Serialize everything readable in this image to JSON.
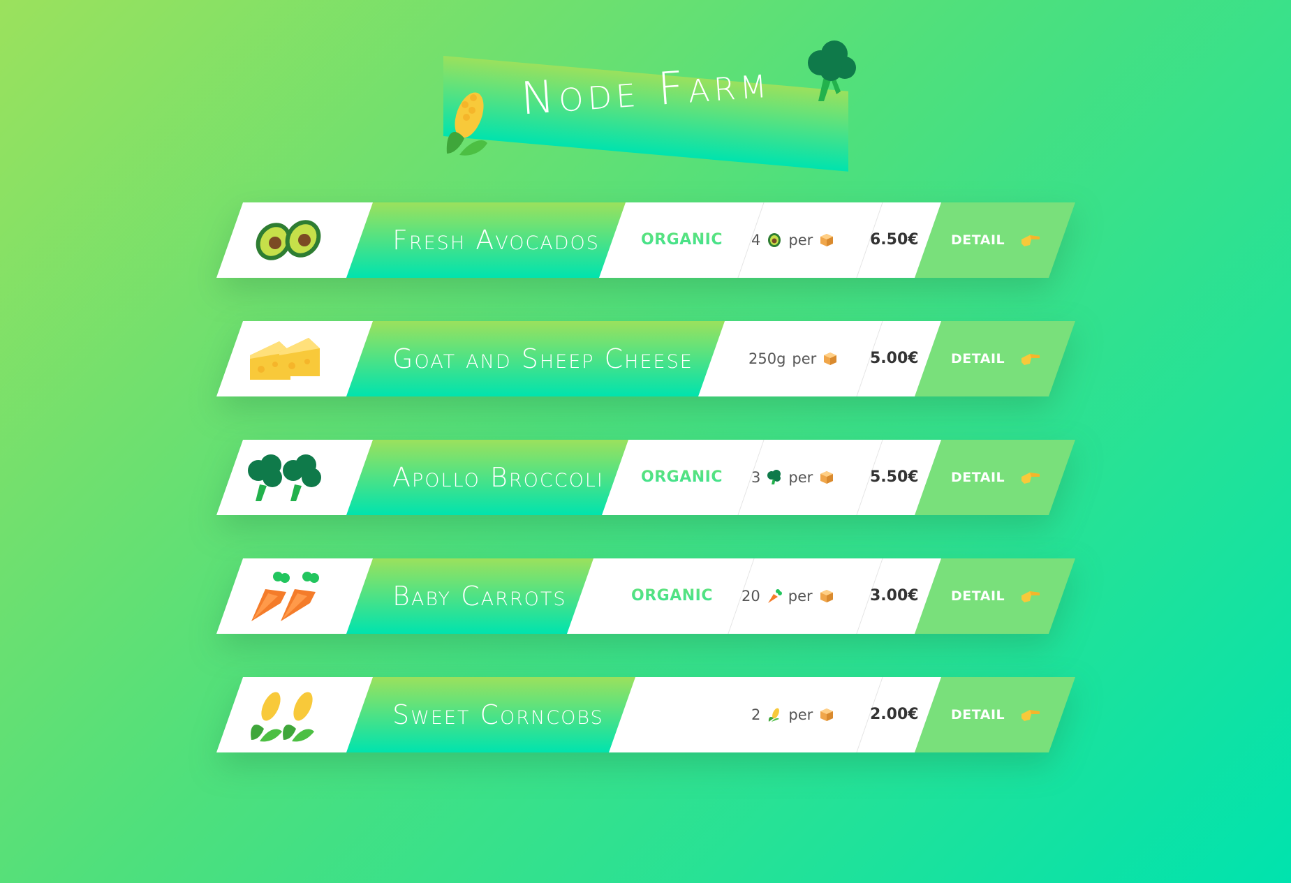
{
  "app": {
    "title": "Node Farm"
  },
  "products": [
    {
      "name": "Fresh Avocados",
      "icon": "avocado-icon",
      "organic": true,
      "organic_label": "ORGANIC",
      "quantity": "4",
      "per_label": "per",
      "price": "6.50€",
      "detail_label": "DETAIL"
    },
    {
      "name": "Goat and Sheep Cheese",
      "icon": "cheese-icon",
      "organic": false,
      "quantity": "250g",
      "per_label": "per",
      "price": "5.00€",
      "detail_label": "DETAIL"
    },
    {
      "name": "Apollo Broccoli",
      "icon": "broccoli-icon",
      "organic": true,
      "organic_label": "ORGANIC",
      "quantity": "3",
      "per_label": "per",
      "price": "5.50€",
      "detail_label": "DETAIL"
    },
    {
      "name": "Baby Carrots",
      "icon": "carrot-icon",
      "organic": true,
      "organic_label": "ORGANIC",
      "quantity": "20",
      "per_label": "per",
      "price": "3.00€",
      "detail_label": "DETAIL"
    },
    {
      "name": "Sweet Corncobs",
      "icon": "corn-icon",
      "organic": false,
      "quantity": "2",
      "per_label": "per",
      "price": "2.00€",
      "detail_label": "DETAIL"
    }
  ],
  "colors": {
    "gradient_start": "#9be15d",
    "gradient_end": "#00e3ae",
    "detail_bg": "#79e07b",
    "price_text": "#333333"
  }
}
